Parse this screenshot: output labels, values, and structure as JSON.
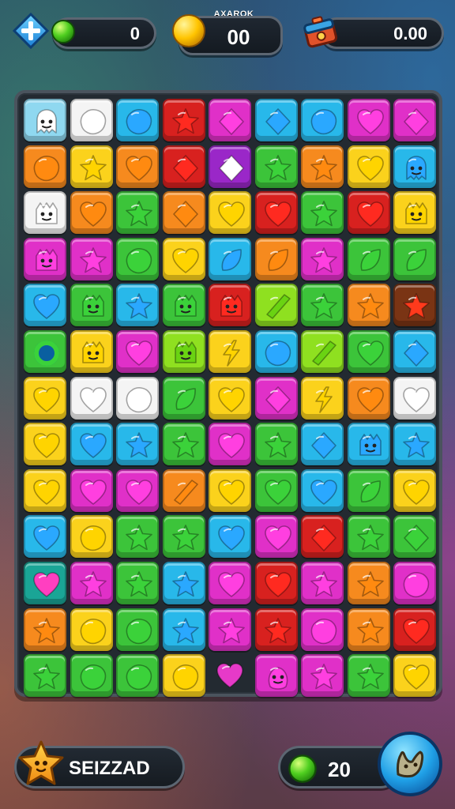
{
  "hud": {
    "plus_icon": "plus-icon",
    "gems": {
      "icon": "green-gem-icon",
      "value": "0"
    },
    "coins": {
      "title": "AXAROK",
      "icon": "gold-coin-icon",
      "value": "00"
    },
    "boxes": {
      "icon": "treasure-box-icon",
      "value": "0.00"
    }
  },
  "board": {
    "palette": {
      "lightblue": "#8fd8f0",
      "white": "#f4f4f4",
      "cyan": "#28b8ea",
      "red": "#d8211f",
      "magenta": "#e030c8",
      "orange": "#f68a1e",
      "yellow": "#fbd21c",
      "purple": "#9a27c8",
      "green": "#3cc43a",
      "lime": "#8fe020",
      "brown": "#7a3414",
      "teal": "#1aa596",
      "pink": "#ee3ca8"
    },
    "rows": [
      [
        [
          "lightblue",
          "ghost"
        ],
        [
          "white",
          "blob"
        ],
        [
          "cyan",
          "blob"
        ],
        [
          "red",
          "star"
        ],
        [
          "magenta",
          "diamond"
        ],
        [
          "cyan",
          "diamond"
        ],
        [
          "cyan",
          "blob"
        ],
        [
          "magenta",
          "heart"
        ],
        [
          "magenta",
          "diamond"
        ]
      ],
      [
        [
          "orange",
          "blob"
        ],
        [
          "yellow",
          "star"
        ],
        [
          "orange",
          "heart"
        ],
        [
          "red",
          "diamond"
        ],
        [
          "purple",
          "diamond"
        ],
        [
          "green",
          "star"
        ],
        [
          "orange",
          "star"
        ],
        [
          "yellow",
          "heart"
        ],
        [
          "cyan",
          "ghost"
        ]
      ],
      [
        [
          "white",
          "face"
        ],
        [
          "orange",
          "heart"
        ],
        [
          "green",
          "star"
        ],
        [
          "orange",
          "diamond"
        ],
        [
          "yellow",
          "heart"
        ],
        [
          "red",
          "heart"
        ],
        [
          "green",
          "star"
        ],
        [
          "red",
          "heart"
        ],
        [
          "yellow",
          "face"
        ]
      ],
      [
        [
          "magenta",
          "face"
        ],
        [
          "magenta",
          "star"
        ],
        [
          "green",
          "blob"
        ],
        [
          "yellow",
          "heart"
        ],
        [
          "cyan",
          "leaf"
        ],
        [
          "orange",
          "leaf"
        ],
        [
          "magenta",
          "star"
        ],
        [
          "green",
          "leaf"
        ],
        [
          "green",
          "leaf"
        ]
      ],
      [
        [
          "cyan",
          "heart"
        ],
        [
          "green",
          "face"
        ],
        [
          "cyan",
          "star"
        ],
        [
          "green",
          "face"
        ],
        [
          "red",
          "face"
        ],
        [
          "lime",
          "stick"
        ],
        [
          "green",
          "star"
        ],
        [
          "orange",
          "star"
        ],
        [
          "brown",
          "star"
        ]
      ],
      [
        [
          "green",
          "ring"
        ],
        [
          "yellow",
          "face"
        ],
        [
          "magenta",
          "heart"
        ],
        [
          "lime",
          "face"
        ],
        [
          "yellow",
          "bolt"
        ],
        [
          "cyan",
          "blob"
        ],
        [
          "lime",
          "stick"
        ],
        [
          "green",
          "heart"
        ],
        [
          "cyan",
          "diamond"
        ]
      ],
      [
        [
          "yellow",
          "heart"
        ],
        [
          "white",
          "heart"
        ],
        [
          "white",
          "blob"
        ],
        [
          "green",
          "leaf"
        ],
        [
          "yellow",
          "heart"
        ],
        [
          "magenta",
          "diamond"
        ],
        [
          "yellow",
          "bolt"
        ],
        [
          "orange",
          "heart"
        ],
        [
          "white",
          "heart"
        ]
      ],
      [
        [
          "yellow",
          "heart"
        ],
        [
          "cyan",
          "heart"
        ],
        [
          "cyan",
          "star"
        ],
        [
          "green",
          "star"
        ],
        [
          "magenta",
          "heart"
        ],
        [
          "green",
          "star"
        ],
        [
          "cyan",
          "diamond"
        ],
        [
          "cyan",
          "face"
        ],
        [
          "cyan",
          "star"
        ]
      ],
      [
        [
          "yellow",
          "heart"
        ],
        [
          "magenta",
          "heart"
        ],
        [
          "magenta",
          "heart"
        ],
        [
          "orange",
          "stick"
        ],
        [
          "yellow",
          "heart"
        ],
        [
          "green",
          "heart"
        ],
        [
          "cyan",
          "heart"
        ],
        [
          "green",
          "leaf"
        ],
        [
          "yellow",
          "heart"
        ]
      ],
      [
        [
          "cyan",
          "heart"
        ],
        [
          "yellow",
          "blob"
        ],
        [
          "green",
          "star"
        ],
        [
          "green",
          "star"
        ],
        [
          "cyan",
          "heart"
        ],
        [
          "magenta",
          "heart"
        ],
        [
          "red",
          "diamond"
        ],
        [
          "green",
          "star"
        ],
        [
          "green",
          "diamond"
        ]
      ],
      [
        [
          "teal",
          "heart"
        ],
        [
          "magenta",
          "star"
        ],
        [
          "green",
          "star"
        ],
        [
          "cyan",
          "star"
        ],
        [
          "magenta",
          "heart"
        ],
        [
          "red",
          "heart"
        ],
        [
          "magenta",
          "star"
        ],
        [
          "orange",
          "star"
        ],
        [
          "magenta",
          "blob"
        ]
      ],
      [
        [
          "orange",
          "star"
        ],
        [
          "yellow",
          "blob"
        ],
        [
          "green",
          "blob"
        ],
        [
          "cyan",
          "star"
        ],
        [
          "magenta",
          "star"
        ],
        [
          "red",
          "star"
        ],
        [
          "magenta",
          "blob"
        ],
        [
          "orange",
          "star"
        ],
        [
          "red",
          "heart"
        ]
      ],
      [
        [
          "green",
          "star"
        ],
        [
          "green",
          "blob"
        ],
        [
          "green",
          "blob"
        ],
        [
          "yellow",
          "blob"
        ],
        [
          "empty",
          "heart"
        ],
        [
          "magenta",
          "creature"
        ],
        [
          "magenta",
          "star"
        ],
        [
          "green",
          "star"
        ],
        [
          "yellow",
          "heart"
        ]
      ]
    ]
  },
  "bottom": {
    "left": {
      "icon": "star-character-icon",
      "label": "SEIZZAD"
    },
    "right": {
      "icon": "green-gem-icon",
      "value": "20",
      "button_icon": "creature-icon"
    }
  }
}
